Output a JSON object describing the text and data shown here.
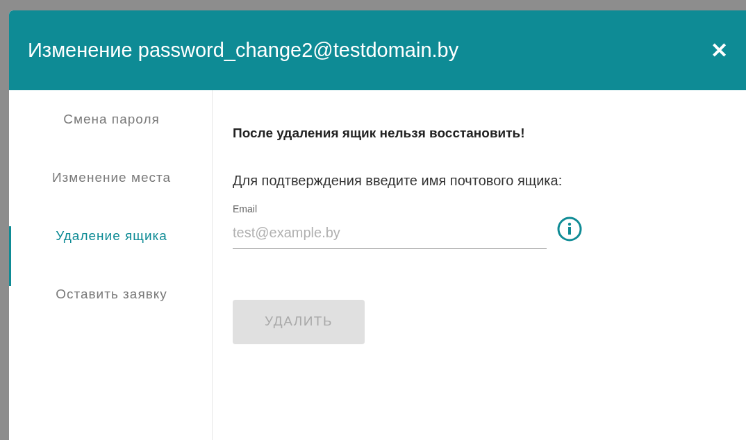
{
  "dialog": {
    "title": "Изменение password_change2@testdomain.by",
    "close": "✕"
  },
  "sidebar": {
    "items": [
      {
        "label": "Смена пароля",
        "selected": false
      },
      {
        "label": "Изменение места",
        "selected": false
      },
      {
        "label": "Удаление ящика",
        "selected": true
      },
      {
        "label": "Оставить заявку",
        "selected": false
      }
    ]
  },
  "content": {
    "warning": "После удаления ящик нельзя восстановить!",
    "prompt": "Для подтверждения введите имя почтового ящика:",
    "email_field": {
      "label": "Email",
      "placeholder": "test@example.by"
    },
    "delete_button": {
      "label": "УДАЛИТЬ",
      "disabled": true
    }
  }
}
